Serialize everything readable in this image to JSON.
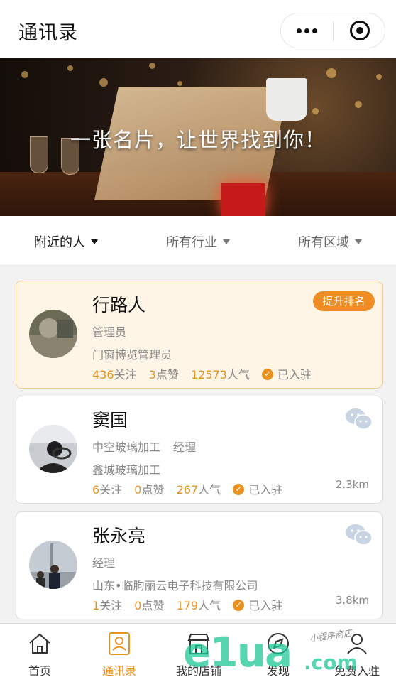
{
  "header": {
    "title": "通讯录"
  },
  "banner": {
    "slogan": "一张名片，让世界找到你！"
  },
  "filters": [
    {
      "label": "附近的人"
    },
    {
      "label": "所有行业"
    },
    {
      "label": "所有区域"
    }
  ],
  "cards": [
    {
      "name": "行路人",
      "role": "管理员",
      "position": "",
      "company": "门窗博览管理员",
      "follows": "436",
      "follows_label": "关注",
      "likes": "3",
      "likes_label": "点赞",
      "popularity": "12573",
      "popularity_label": "人气",
      "status": "已入驻",
      "badge": "提升排名",
      "distance": ""
    },
    {
      "name": "窦国",
      "role": "中空玻璃加工",
      "position": "经理",
      "company": "鑫城玻璃加工",
      "follows": "6",
      "follows_label": "关注",
      "likes": "0",
      "likes_label": "点赞",
      "popularity": "267",
      "popularity_label": "人气",
      "status": "已入驻",
      "badge": "",
      "distance": "2.3km"
    },
    {
      "name": "张永亮",
      "role": "经理",
      "position": "",
      "company": "山东•临朐丽云电子科技有限公司",
      "follows": "1",
      "follows_label": "关注",
      "likes": "0",
      "likes_label": "点赞",
      "popularity": "179",
      "popularity_label": "人气",
      "status": "已入驻",
      "badge": "",
      "distance": "3.8km"
    }
  ],
  "tabbar": [
    {
      "label": "首页",
      "icon": "home-icon"
    },
    {
      "label": "通讯录",
      "icon": "contacts-icon"
    },
    {
      "label": "我的店铺",
      "icon": "store-icon"
    },
    {
      "label": "发现",
      "icon": "compass-icon"
    },
    {
      "label": "免费入驻",
      "icon": "user-add-icon"
    }
  ],
  "watermark": {
    "main": "e1ua",
    "domain": ".com",
    "sub": "小程序商店"
  },
  "colors": {
    "accent": "#e8911f",
    "featured_bg": "#fff5e6",
    "badge": "#ef8c24",
    "wechat_icon": "#c8d4e4"
  }
}
